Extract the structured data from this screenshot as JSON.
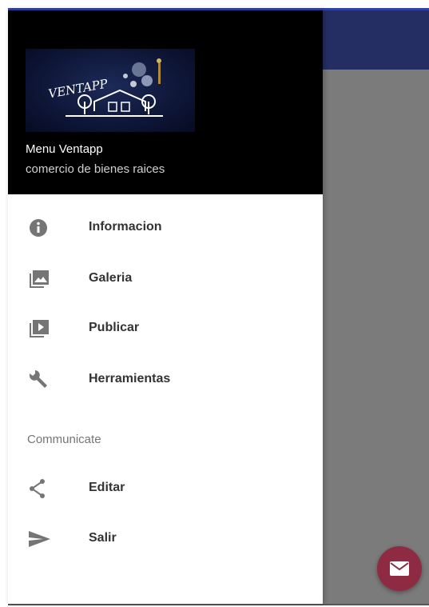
{
  "drawer": {
    "header": {
      "logo_text": "VENTAPP",
      "title": "Menu Ventapp",
      "subtitle": "comercio de bienes raices"
    },
    "items": [
      {
        "label": "Informacion",
        "icon": "info-icon"
      },
      {
        "label": "Galeria",
        "icon": "gallery-icon"
      },
      {
        "label": "Publicar",
        "icon": "video-library-icon"
      },
      {
        "label": "Herramientas",
        "icon": "wrench-icon"
      }
    ],
    "section": {
      "label": "Communicate",
      "items": [
        {
          "label": "Editar",
          "icon": "share-icon"
        },
        {
          "label": "Salir",
          "icon": "send-icon"
        }
      ]
    }
  },
  "fab": {
    "icon": "mail-icon"
  },
  "colors": {
    "toolbar": "#252e63",
    "scrim": "#7b7b7b",
    "header": "#000000",
    "fab": "#8e2b43",
    "icon": "#757575"
  }
}
